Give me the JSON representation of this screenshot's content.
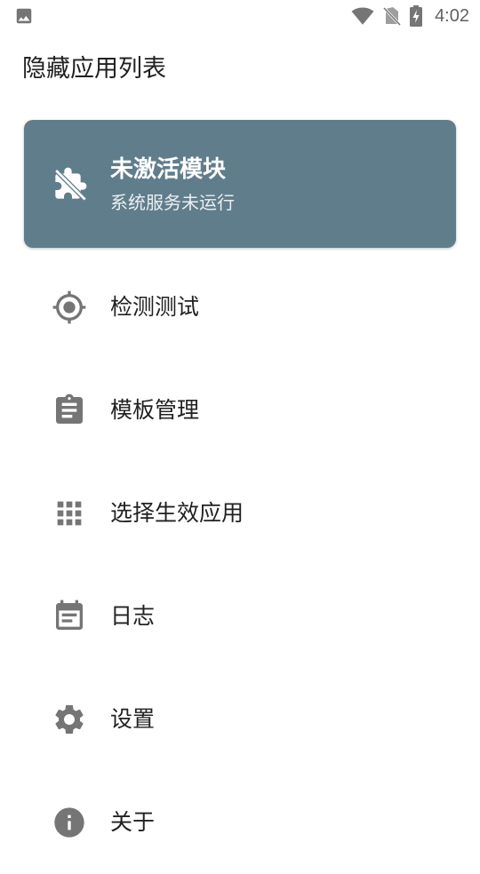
{
  "status_bar": {
    "time": "4:02",
    "left_icon": "image-notification-icon",
    "right_icons": [
      "wifi-icon",
      "no-sim-icon",
      "battery-charging-icon"
    ]
  },
  "app": {
    "title": "隐藏应用列表"
  },
  "status_card": {
    "title": "未激活模块",
    "subtitle": "系统服务未运行",
    "icon": "extension-off-icon",
    "background_color": "#607d8b"
  },
  "menu": {
    "items": [
      {
        "label": "检测测试",
        "icon": "gps-target-icon"
      },
      {
        "label": "模板管理",
        "icon": "clipboard-icon"
      },
      {
        "label": "选择生效应用",
        "icon": "apps-grid-icon"
      },
      {
        "label": "日志",
        "icon": "calendar-log-icon"
      },
      {
        "label": "设置",
        "icon": "gear-icon"
      },
      {
        "label": "关于",
        "icon": "info-icon"
      }
    ]
  },
  "colors": {
    "icon_gray": "#757575",
    "text_primary": "#212121"
  }
}
